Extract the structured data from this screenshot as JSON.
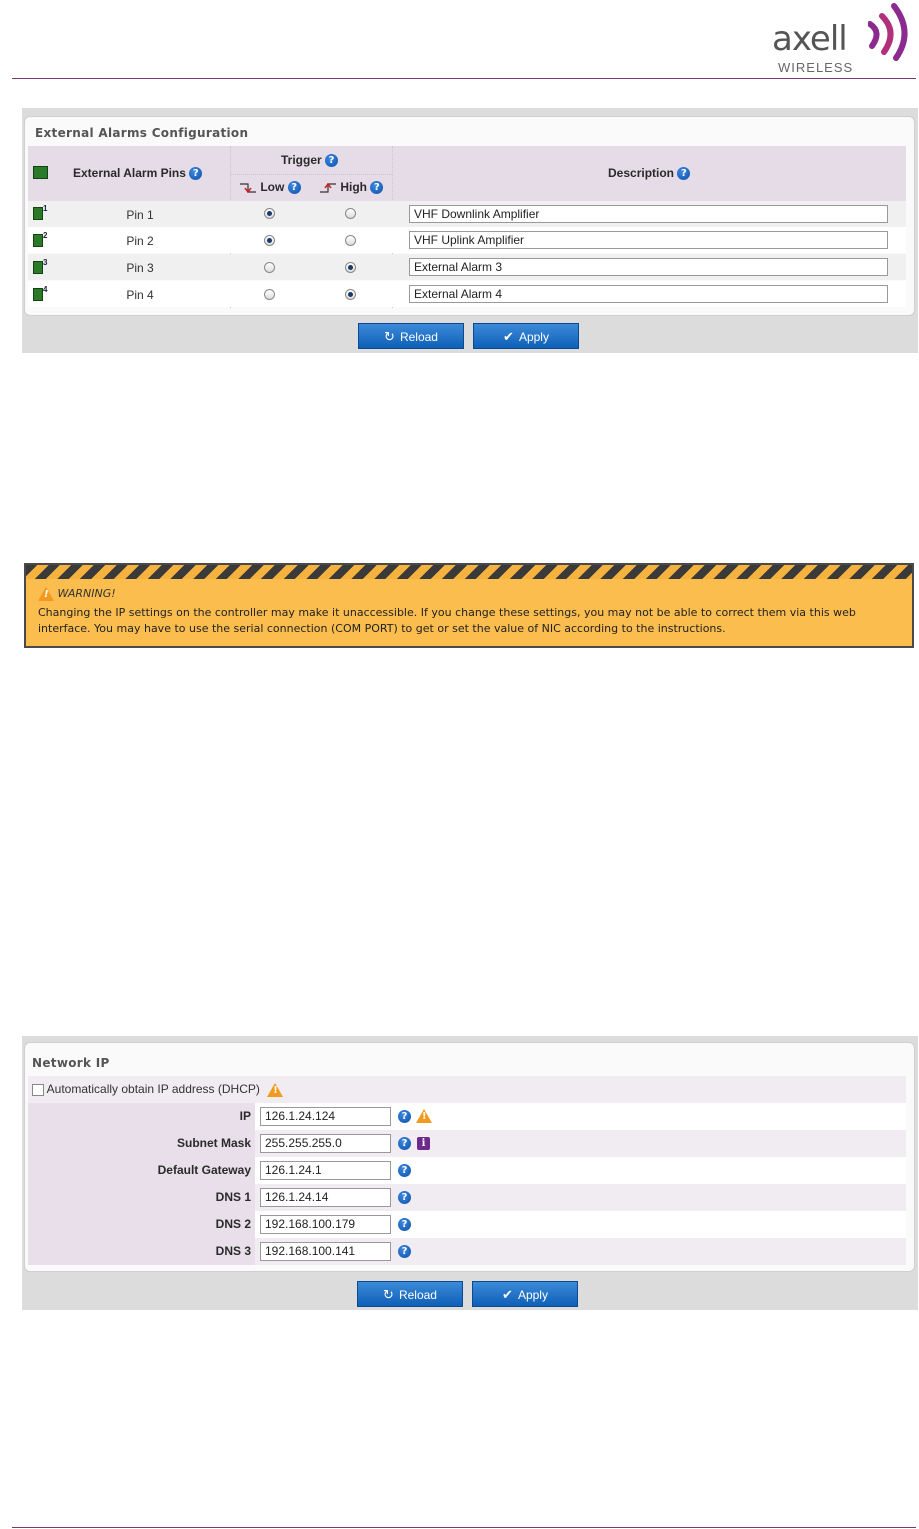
{
  "logo": {
    "word": "axell",
    "sub": "WIRELESS"
  },
  "alarms": {
    "title": "External Alarms Configuration",
    "headers": {
      "pins": "External Alarm Pins",
      "trigger": "Trigger",
      "low": "Low",
      "high": "High",
      "description": "Description"
    },
    "rows": [
      {
        "pin_num": "1",
        "label": "Pin 1",
        "trigger": "low",
        "description": "VHF Downlink Amplifier"
      },
      {
        "pin_num": "2",
        "label": "Pin 2",
        "trigger": "low",
        "description": "VHF Uplink Amplifier"
      },
      {
        "pin_num": "3",
        "label": "Pin 3",
        "trigger": "high",
        "description": "External Alarm 3"
      },
      {
        "pin_num": "4",
        "label": "Pin 4",
        "trigger": "high",
        "description": "External Alarm 4"
      }
    ],
    "reload_label": "Reload",
    "apply_label": "Apply"
  },
  "warning": {
    "title": "WARNING!",
    "body": "Changing the IP settings on the controller may make it unaccessible. If you change these settings, you may not be able to correct them via this web interface. You may have to use the serial connection (COM PORT) to get or set the value of NIC according to the instructions."
  },
  "network": {
    "title": "Network IP",
    "dhcp_label": "Automatically obtain IP address (DHCP)",
    "dhcp_checked": false,
    "fields": [
      {
        "label": "IP",
        "value": "126.1.24.124",
        "extra": "warning-icon"
      },
      {
        "label": "Subnet Mask",
        "value": "255.255.255.0",
        "extra": "info-icon"
      },
      {
        "label": "Default Gateway",
        "value": "126.1.24.1"
      },
      {
        "label": "DNS 1",
        "value": "126.1.24.14"
      },
      {
        "label": "DNS 2",
        "value": "192.168.100.179"
      },
      {
        "label": "DNS 3",
        "value": "192.168.100.141"
      }
    ],
    "reload_label": "Reload",
    "apply_label": "Apply"
  },
  "colors": {
    "accent": "#0e5fb8",
    "header_bg": "#e6dce8",
    "warning_bg": "#fbbd4d",
    "brand_purple": "#7a3a7a"
  }
}
